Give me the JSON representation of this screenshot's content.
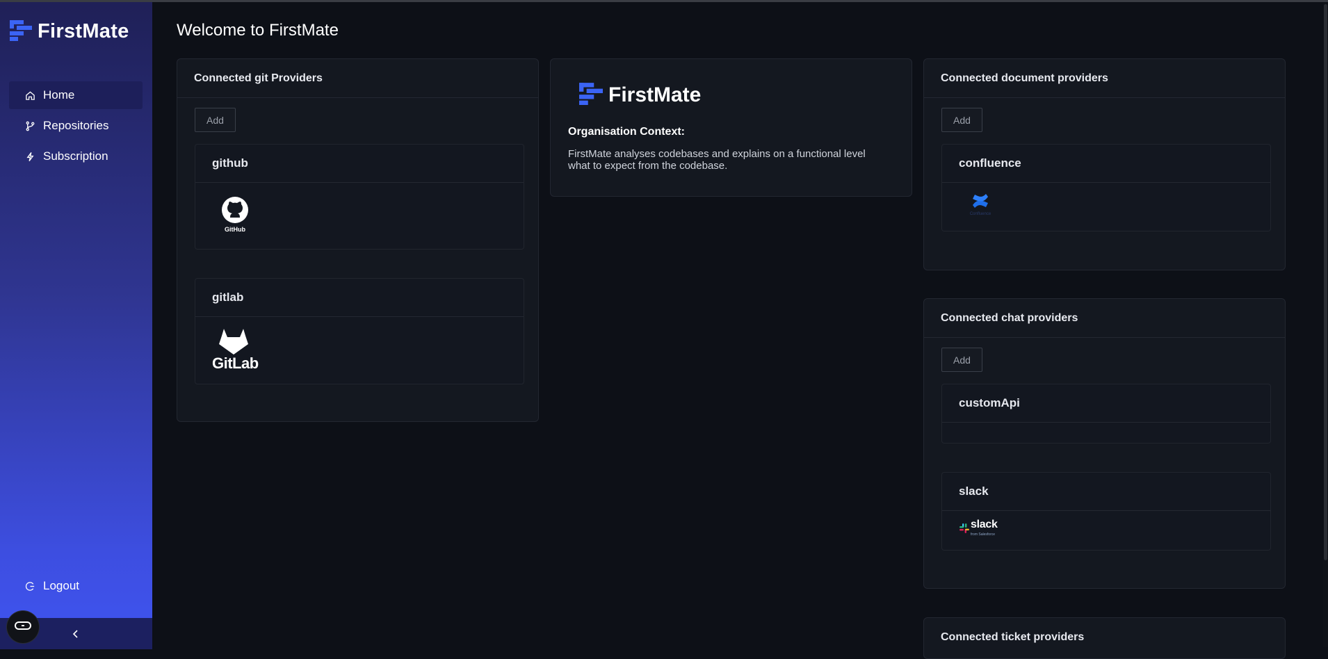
{
  "app": {
    "brand": "FirstMate",
    "colors": {
      "accent": "#3b64f5",
      "sidebar_top": "#1f2057",
      "sidebar_bottom": "#3f54f0",
      "background": "#0d1017",
      "card": "#141820"
    }
  },
  "sidebar": {
    "items": [
      {
        "label": "Home",
        "icon": "home-icon",
        "active": true
      },
      {
        "label": "Repositories",
        "icon": "branch-icon",
        "active": false
      },
      {
        "label": "Subscription",
        "icon": "bolt-icon",
        "active": false
      }
    ],
    "logout_label": "Logout",
    "collapse_icon": "chevron-left-icon"
  },
  "main": {
    "title": "Welcome to FirstMate",
    "git_card": {
      "title": "Connected git Providers",
      "add_label": "Add",
      "providers": [
        {
          "name": "github",
          "logo_caption": "GitHub"
        },
        {
          "name": "gitlab",
          "logo_caption": "GitLab"
        }
      ]
    },
    "context_card": {
      "brand": "FirstMate",
      "heading": "Organisation Context:",
      "text": "FirstMate analyses codebases and explains on a functional level what to expect from the codebase."
    },
    "document_card": {
      "title": "Connected document providers",
      "add_label": "Add",
      "providers": [
        {
          "name": "confluence",
          "logo_caption": "Confluence"
        }
      ]
    },
    "chat_card": {
      "title": "Connected chat providers",
      "add_label": "Add",
      "providers": [
        {
          "name": "customApi"
        },
        {
          "name": "slack",
          "logo_caption": "slack",
          "logo_subcaption": "from Salesforce"
        }
      ]
    },
    "ticket_card": {
      "title": "Connected ticket providers"
    }
  }
}
